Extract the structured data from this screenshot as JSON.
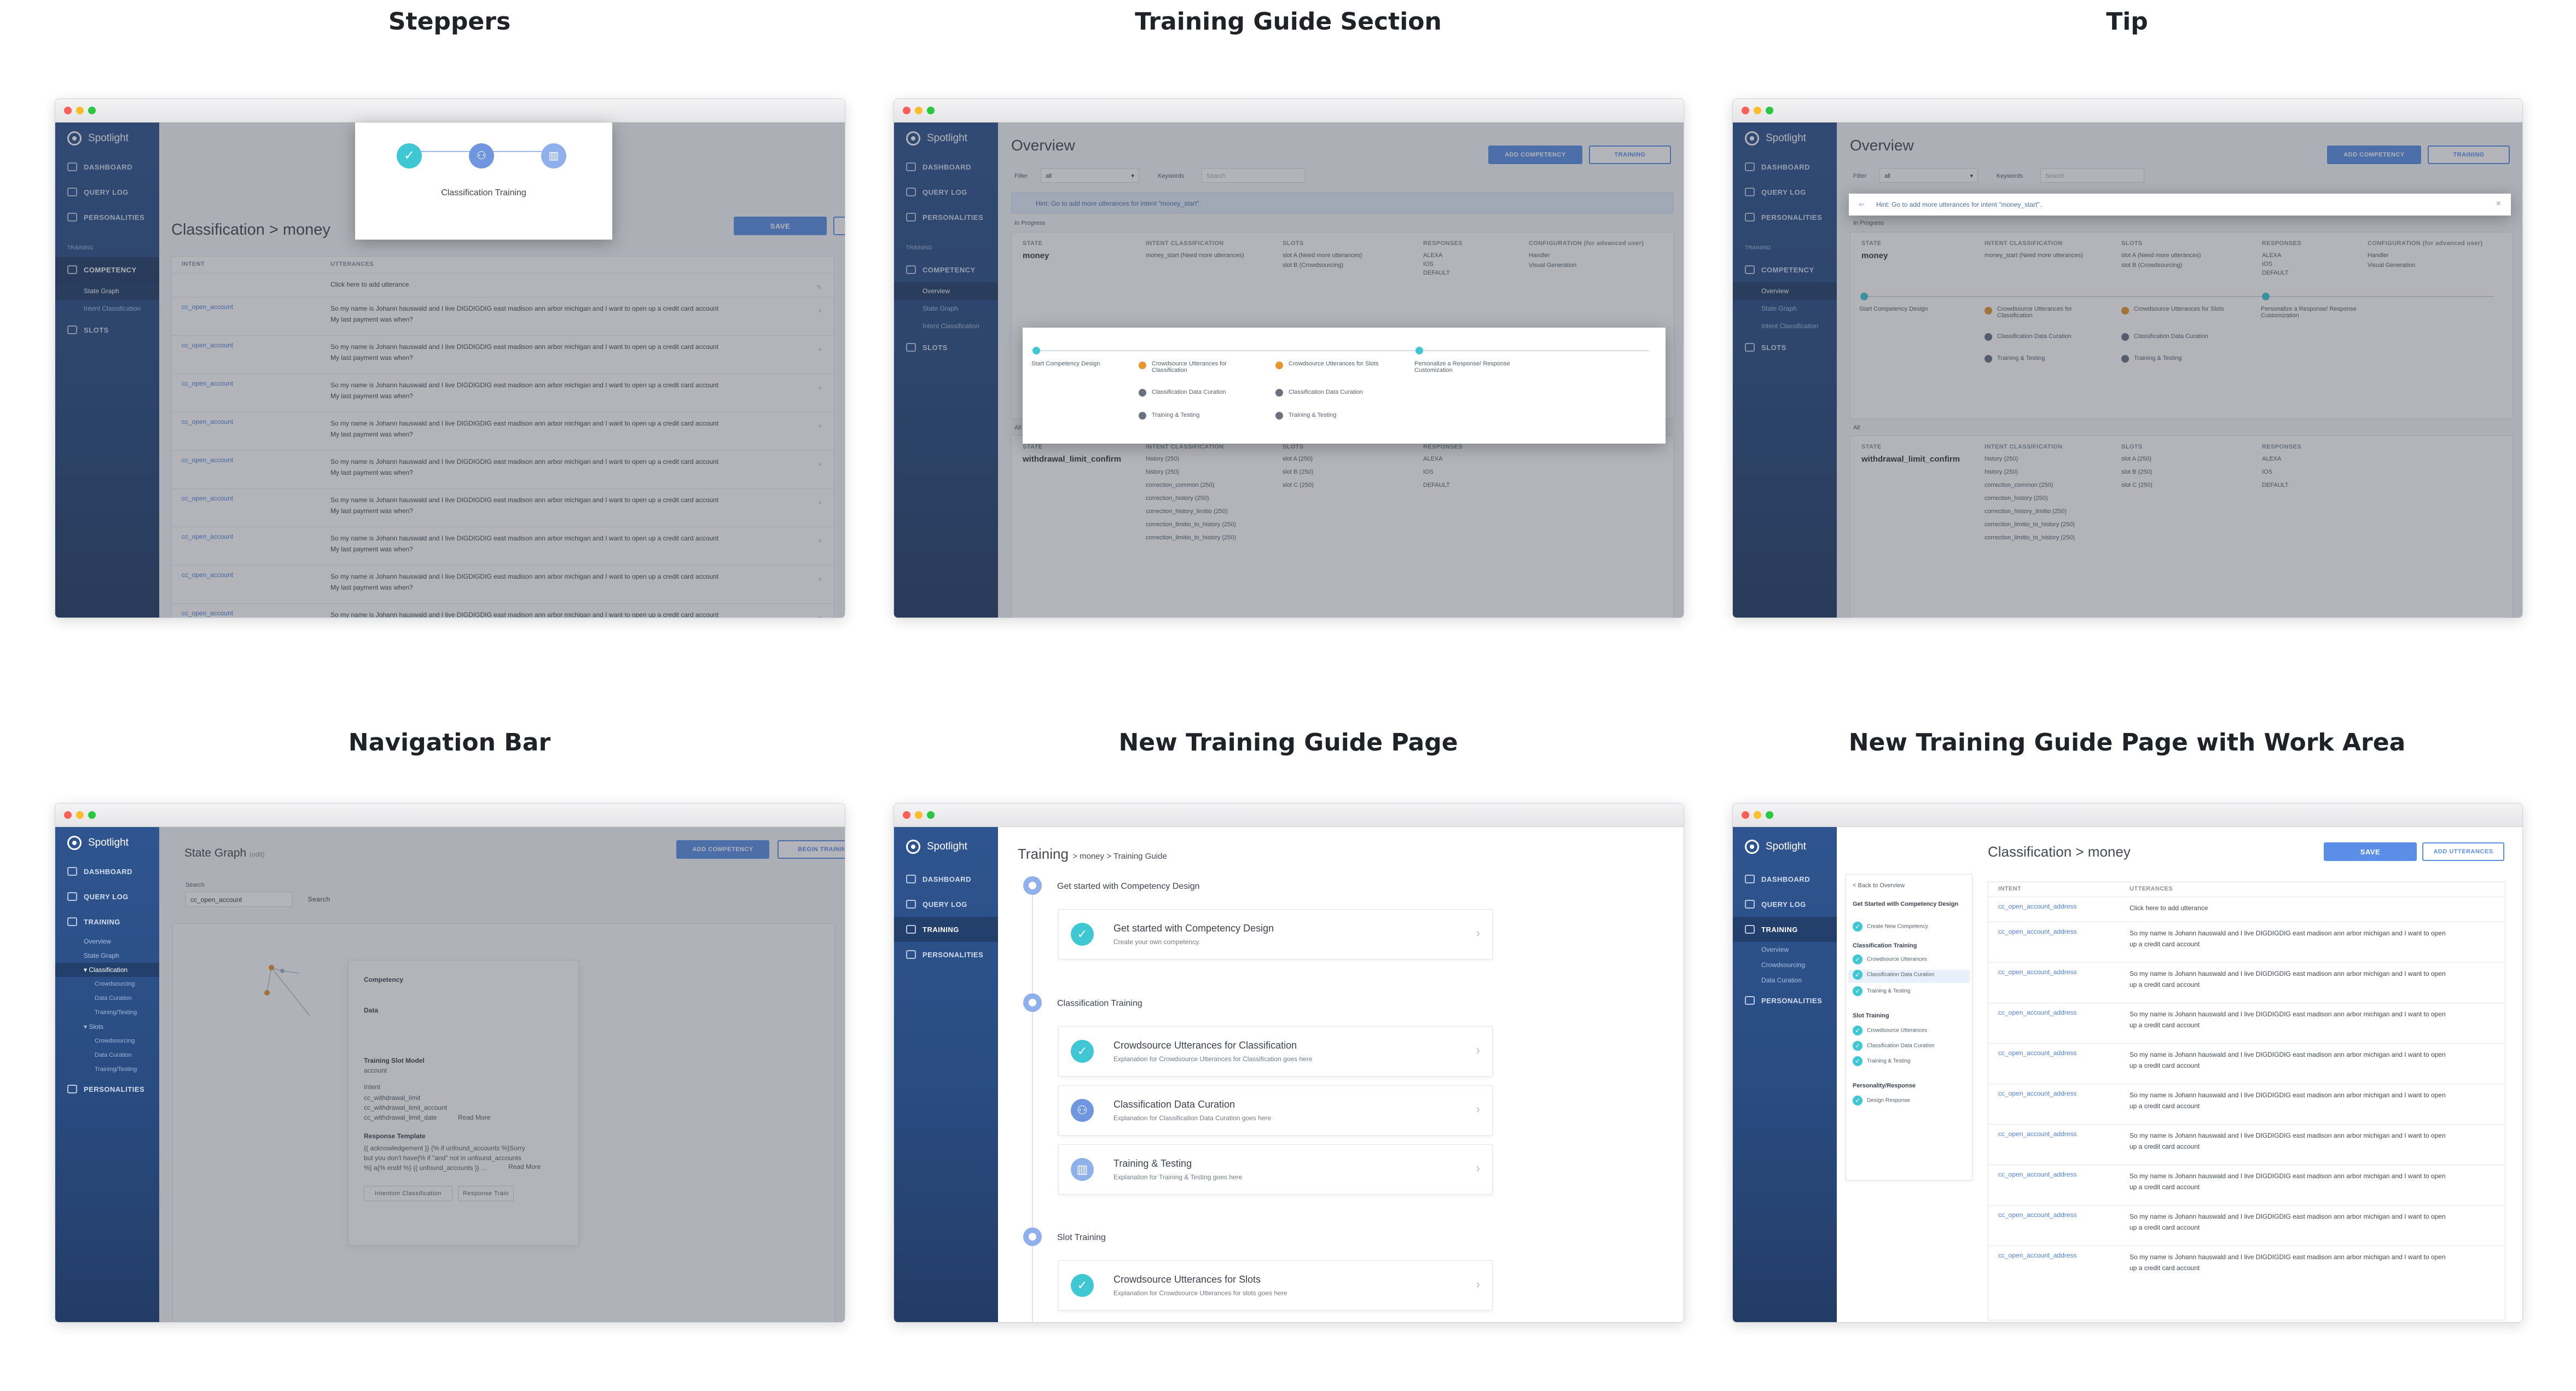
{
  "panels": {
    "p1": "Steppers",
    "p2": "Training Guide Section",
    "p3": "Tip",
    "p4": "Navigation Bar",
    "p5": "New Training Guide Page",
    "p6": "New Training Guide Page with Work Area"
  },
  "brand": "Spotlight",
  "nav": {
    "dashboard": "DASHBOARD",
    "query_log": "QUERY LOG",
    "personalities": "PERSONALITIES",
    "training": "TRAINING",
    "competency": "COMPETENCY",
    "overview": "Overview",
    "state_graph": "State Graph",
    "intent_classification": "Intent Classification",
    "classification": "Classification",
    "crowdsourcing": "Crowdsourcing",
    "data_curation": "Data Curation",
    "training_testing": "Training/Testing",
    "slots": "SLOTS",
    "slots_sub": "Slots"
  },
  "buttons": {
    "save": "SAVE",
    "add_utterances": "ADD UTTERANCES",
    "add_competency": "ADD COMPETENCY",
    "training": "TRAINING",
    "begin_training": "BEGIN TRAINING",
    "search": "Search"
  },
  "stepper": {
    "label": "Classification Training",
    "breadcrumb": "Classification > money",
    "col_intent": "INTENT",
    "col_utterances": "UTTERANCES",
    "placeholder": "Click here to add utterance",
    "intent": "cc_open_account",
    "utterance_line1": "So my name is Johann hauswald and I  live DIGDIGDIG east madison ann arbor michigan and I want to open up a credit card account",
    "utterance_line2": "My last payment was when?"
  },
  "overview": {
    "title": "Overview",
    "filter_label": "Filter",
    "filter_value": "all",
    "keywords_label": "Keywords",
    "keywords_placeholder": "Search",
    "hint": "Hint: Go to add more utterances for intent \"money_start\".",
    "in_progress": "In Progress",
    "all": "All",
    "col_state": "STATE",
    "col_intent": "INTENT CLASSIFICATION",
    "col_slots": "SLOTS",
    "col_responses": "RESPONSES",
    "col_config": "CONFIGURATION (for advanced user)",
    "state1": "money",
    "intent1": "money_start (Need more utterances)",
    "slot1a": "slot A (Need more utterances)",
    "slot1b": "slot B (Crowdsourcing)",
    "resp_alexa": "ALEXA",
    "resp_ios": "IOS",
    "resp_default": "DEFAULT",
    "config1": "Handler",
    "config2": "Visual Generation",
    "guide_start": "Start Competency Design",
    "guide_crowd_class": "Crowdsource Utterances for Classification",
    "guide_class_cur": "Classification Data Curation",
    "guide_train_test": "Training & Testing",
    "guide_crowd_slots": "Crowdsource Utterances for Slots",
    "guide_personalize": "Personalize a Response/ Response Customization",
    "state2": "withdrawal_limit_confirm",
    "intents2": [
      "history (250)",
      "history (250)",
      "correction_common (250)",
      "correction_history (250)",
      "correction_history_limitio (250)",
      "correction_limitio_to_history (250)",
      "correction_limitio_to_history (250)"
    ],
    "slots2": [
      "slot A (250)",
      "slot B (250)",
      "slot C (250)"
    ]
  },
  "state_graph": {
    "title": "State Graph",
    "edit": "(edit)",
    "search_label": "Search",
    "search_value": "cc_open_account",
    "competency": "Competency",
    "data": "Data",
    "training_slot_model": "Training Slot Model",
    "account": "account",
    "intent_label": "Intent",
    "intents": [
      "cc_withdrawal_limit",
      "cc_withdrawal_limit_account",
      "cc_withdrawal_limit_date"
    ],
    "read_more": "Read More",
    "response_template": "Response Template",
    "template_text": "{{ acknowledgement }} {% if unfound_accounts %}Sorry but you don't have{% if \"and\" not in unfound_accounts %} a{% endif %} {{ unfound_accounts }} ...",
    "btn1": "Intention Classification",
    "btn2": "Response Train"
  },
  "guide": {
    "title": "Training",
    "crumb": "> money > Training Guide",
    "sec1": "Get started with Competency Design",
    "c1_title": "Get started with Competency Design",
    "c1_desc": "Create your own competency.",
    "sec2": "Classification Training",
    "c2_title": "Crowdsource Utterances for Classification",
    "c2_desc": "Explanation for Crowdsource Utterances for Classification goes here",
    "c3_title": "Classification Data Curation",
    "c3_desc": "Explanation for Classification Data Curation goes here",
    "c4_title": "Training & Testing",
    "c4_desc": "Explanation for Training & Testing  goes here",
    "sec3": "Slot Training",
    "c5_title": "Crowdsource Utterances for Slots",
    "c5_desc": "Explanation for Crowdsource Utterances for slots goes here"
  },
  "work": {
    "back": "< Back to Overview",
    "g1": "Get Started with Competency Design",
    "g1_i1": "Create New Competency",
    "g2": "Classification Training",
    "g2_i1": "Crowdsource Utterances",
    "g2_i2": "Classification Data Curation",
    "g2_i3": "Training & Testing",
    "g3": "Slot Training",
    "g3_i1": "Crowdsource Utterances",
    "g3_i2": "Classification Data Curation",
    "g3_i3": "Training & Testing",
    "g4": "Personality/Response",
    "g4_i1": "Design Response",
    "heading": "Classification > money",
    "intent": "cc_open_account_address",
    "utterance_line1": "So my name is Johann hauswald and I  live DIGDIGDIG east madison ann arbor michigan and I want to open",
    "utterance_line2": "up a credit card account"
  },
  "colors": {
    "sidebar": "#2f5590",
    "accent": "#5b8ee6",
    "teal": "#3fc8d4",
    "orange": "#e5962f"
  }
}
